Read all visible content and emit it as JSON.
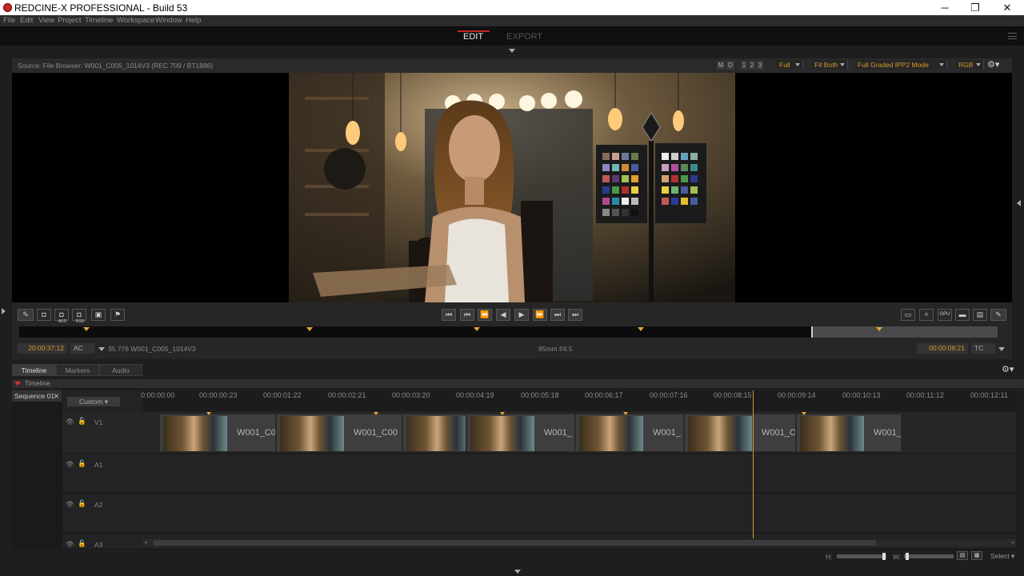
{
  "window": {
    "title": "REDCINE-X PROFESSIONAL - Build 53",
    "minimize": "─",
    "maximize": "❐",
    "close": "✕"
  },
  "menu": [
    "File",
    "Edit",
    "View",
    "Project",
    "Timeline",
    "Workspace",
    "Window",
    "Help"
  ],
  "modes": {
    "edit": "EDIT",
    "export": "EXPORT"
  },
  "viewer": {
    "source": "Source: File Browser: W001_C005_1014V3    (REC 709 / BT1886)",
    "m": "M",
    "d": "D",
    "one": "1",
    "two": "2",
    "three": "3",
    "quality": "Full",
    "fit": "Fit Both",
    "mode": "Full Graded IPP2 Mode",
    "channel": "RGB",
    "timecode_left": "20:00:37:12",
    "ac": "AC",
    "clipinfo": "35.776 W001_C005_1014V3",
    "lens": "85mm  f/4.5",
    "timecode_right": "00:00:08:21",
    "tc": "TC",
    "add_label": "ADD",
    "rsd_label": "RSD"
  },
  "tabs": [
    "Timeline",
    "Markers",
    "Audio"
  ],
  "timeline": {
    "header": "Timeline",
    "sequence": "Sequence 01",
    "preset": "Custom",
    "ticks": [
      "0:00:00:00",
      "00:00:00:23",
      "00:00:01:22",
      "00:00:02:21",
      "00:00:03:20",
      "00:00:04:19",
      "00:00:05:18",
      "00:00:06:17",
      "00:00:07:16",
      "00:00:08:15",
      "00:00:09:14",
      "00:00:10:13",
      "00:00:11:12",
      "00:00:12:11"
    ],
    "tracks": [
      "V1",
      "A1",
      "A2",
      "A3"
    ],
    "clips": [
      "W001_C0",
      "W001_C00",
      "W001_",
      "W001_",
      "W001_C",
      "W001_"
    ],
    "h_label": "H:",
    "w_label": "W:",
    "select": "Select"
  }
}
